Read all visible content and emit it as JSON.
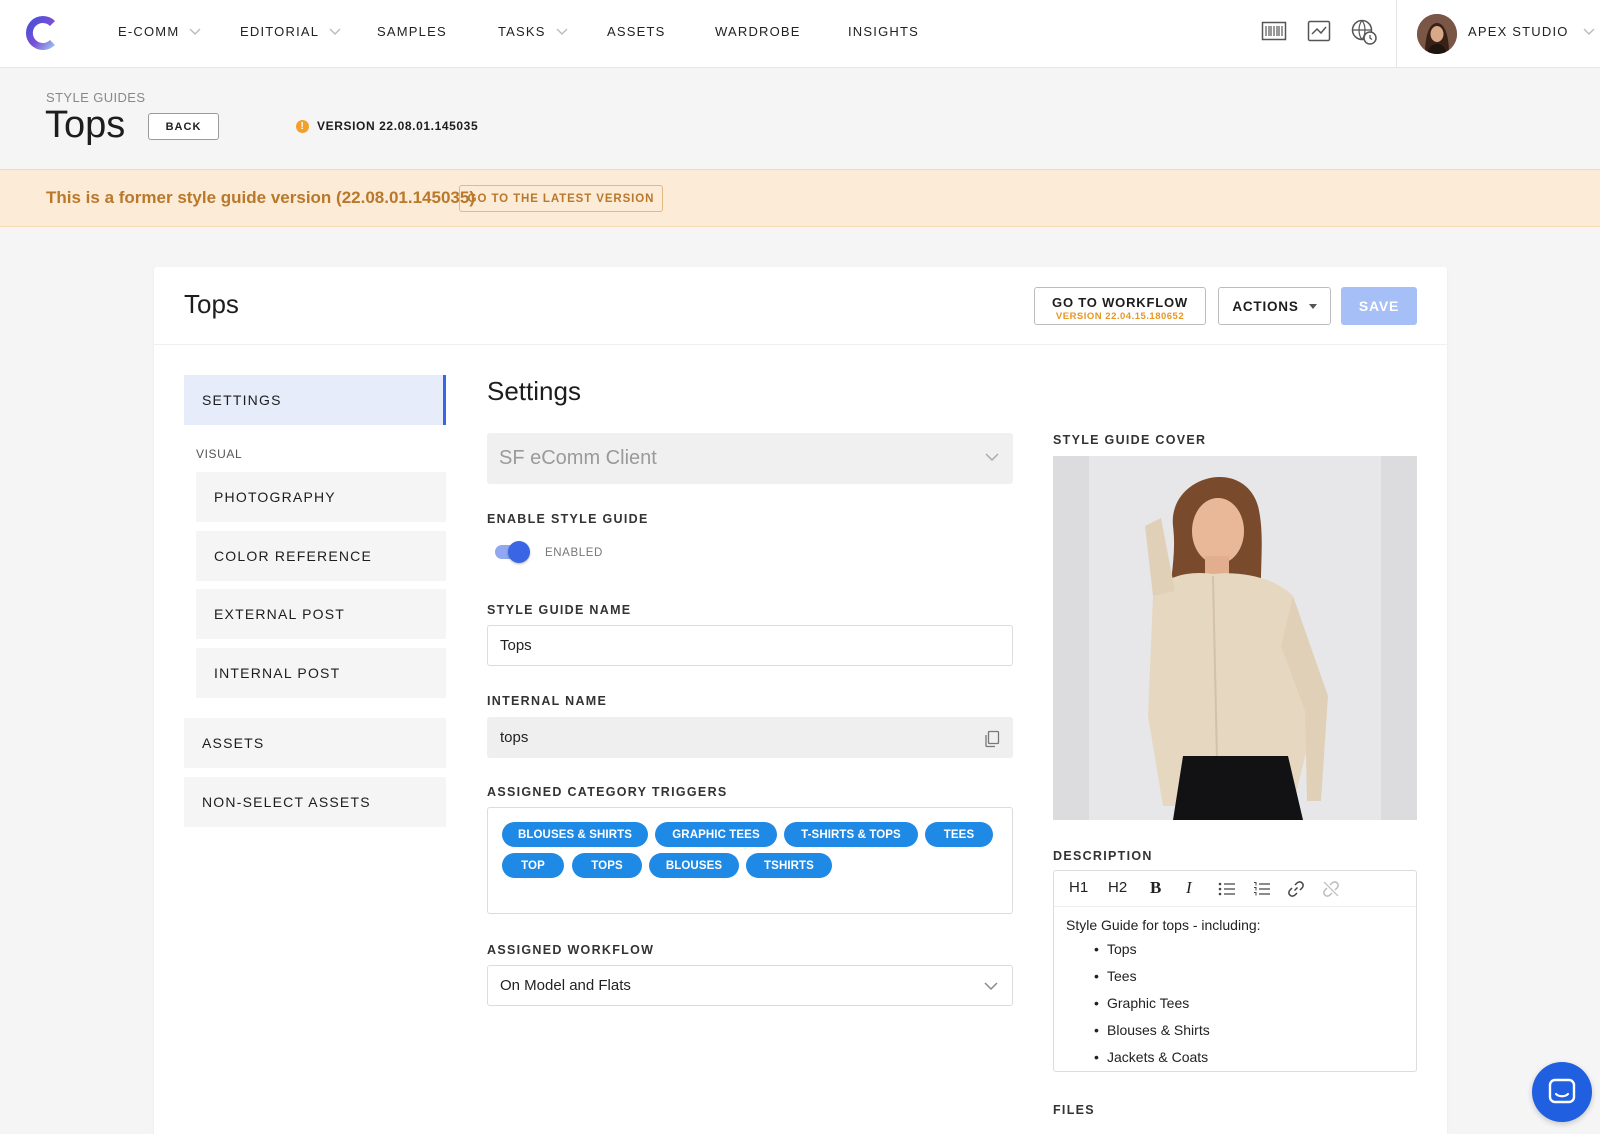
{
  "nav": {
    "items": [
      {
        "label": "E-COMM",
        "dropdown": true
      },
      {
        "label": "EDITORIAL",
        "dropdown": true
      },
      {
        "label": "SAMPLES",
        "dropdown": false
      },
      {
        "label": "TASKS",
        "dropdown": true
      },
      {
        "label": "ASSETS",
        "dropdown": false
      },
      {
        "label": "WARDROBE",
        "dropdown": false
      },
      {
        "label": "INSIGHTS",
        "dropdown": false
      }
    ],
    "icons": [
      "barcode-icon",
      "activity-chart-icon",
      "globe-clock-icon"
    ],
    "studio": "APEX STUDIO"
  },
  "header": {
    "breadcrumb": "STYLE GUIDES",
    "title": "Tops",
    "back_label": "BACK",
    "version": "VERSION 22.08.01.145035",
    "warn_glyph": "!"
  },
  "banner": {
    "text": "This is a former style guide version (22.08.01.145035)",
    "button": "GO TO THE LATEST VERSION"
  },
  "card": {
    "title": "Tops",
    "workflow_btn": "GO TO WORKFLOW",
    "workflow_version": "VERSION 22.04.15.180652",
    "actions_btn": "ACTIONS",
    "save_btn": "SAVE"
  },
  "menu": {
    "settings": "SETTINGS",
    "visual_label": "VISUAL",
    "sub_items": [
      "PHOTOGRAPHY",
      "COLOR REFERENCE",
      "EXTERNAL POST",
      "INTERNAL POST"
    ],
    "assets": "ASSETS",
    "non_select": "NON-SELECT ASSETS"
  },
  "form": {
    "section_title": "Settings",
    "client": "SF eComm Client",
    "enable_label": "ENABLE STYLE GUIDE",
    "toggle_state": "ENABLED",
    "name_label": "STYLE GUIDE NAME",
    "name_value": "Tops",
    "internal_label": "INTERNAL NAME",
    "internal_value": "tops",
    "triggers_label": "ASSIGNED CATEGORY TRIGGERS",
    "tags": [
      "BLOUSES & SHIRTS",
      "GRAPHIC TEES",
      "T-SHIRTS & TOPS",
      "TEES",
      "TOP",
      "TOPS",
      "BLOUSES",
      "TSHIRTS"
    ],
    "workflow_label": "ASSIGNED WORKFLOW",
    "workflow_value": "On Model and Flats"
  },
  "right": {
    "cover_label": "STYLE GUIDE COVER",
    "description_label": "DESCRIPTION",
    "toolbar": {
      "h1": "H1",
      "h2": "H2",
      "bold": "B",
      "italic": "I"
    },
    "description_intro": "Style Guide for tops - including:",
    "description_items": [
      "Tops",
      "Tees",
      "Graphic Tees",
      "Blouses & Shirts",
      "Jackets & Coats"
    ],
    "files_label": "FILES"
  },
  "colors": {
    "accent": "#3a66e6",
    "tag": "#1f8ae6",
    "warning": "#b9782a",
    "version_orange": "#e8961f"
  }
}
